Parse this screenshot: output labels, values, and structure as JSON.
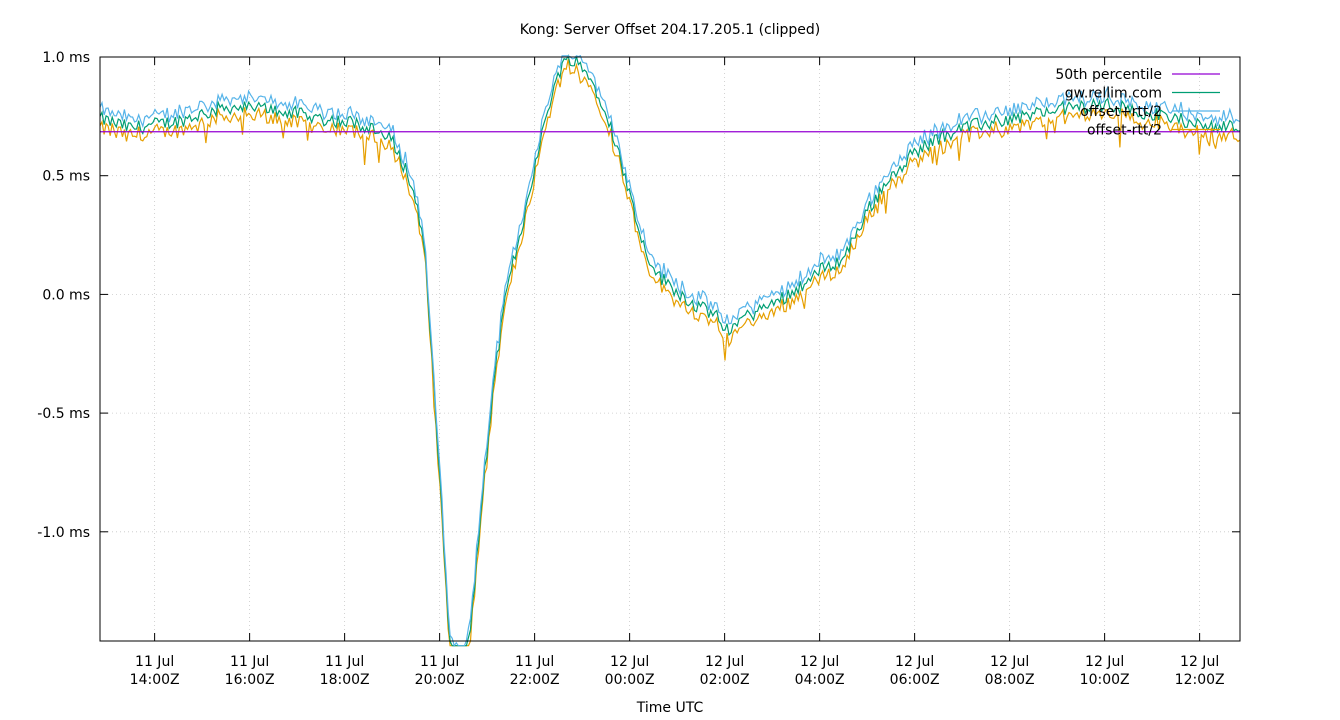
{
  "chart_data": {
    "type": "line",
    "title": "Kong: Server Offset 204.17.205.1 (clipped)",
    "xlabel": "Time UTC",
    "ylabel": "",
    "ylim": [
      -1.46,
      1.0
    ],
    "xlim_hours": [
      12.85,
      36.85
    ],
    "grid": true,
    "legend_position": "top-right",
    "y_ticks": [
      {
        "value": 1.0,
        "label": "1.0 ms"
      },
      {
        "value": 0.5,
        "label": "0.5 ms"
      },
      {
        "value": 0.0,
        "label": "0.0 ms"
      },
      {
        "value": -0.5,
        "label": "-0.5 ms"
      },
      {
        "value": -1.0,
        "label": "-1.0 ms"
      }
    ],
    "x_ticks": [
      {
        "hour": 14,
        "line1": "11 Jul",
        "line2": "14:00Z"
      },
      {
        "hour": 16,
        "line1": "11 Jul",
        "line2": "16:00Z"
      },
      {
        "hour": 18,
        "line1": "11 Jul",
        "line2": "18:00Z"
      },
      {
        "hour": 20,
        "line1": "11 Jul",
        "line2": "20:00Z"
      },
      {
        "hour": 22,
        "line1": "11 Jul",
        "line2": "22:00Z"
      },
      {
        "hour": 24,
        "line1": "12 Jul",
        "line2": "00:00Z"
      },
      {
        "hour": 26,
        "line1": "12 Jul",
        "line2": "02:00Z"
      },
      {
        "hour": 28,
        "line1": "12 Jul",
        "line2": "04:00Z"
      },
      {
        "hour": 30,
        "line1": "12 Jul",
        "line2": "06:00Z"
      },
      {
        "hour": 32,
        "line1": "12 Jul",
        "line2": "08:00Z"
      },
      {
        "hour": 34,
        "line1": "12 Jul",
        "line2": "10:00Z"
      },
      {
        "hour": 36,
        "line1": "12 Jul",
        "line2": "12:00Z"
      }
    ],
    "series": [
      {
        "name": "50th percentile",
        "color": "#9400d3",
        "constant": 0.685
      },
      {
        "name": "gw.rellim.com",
        "color": "#009e73"
      },
      {
        "name": "offset+rtt/2",
        "color": "#56b4e9"
      },
      {
        "name": "offset-rtt/2",
        "color": "#e69f00"
      }
    ],
    "offset_curve": {
      "x_hours": [
        12.85,
        13.5,
        14.5,
        15.5,
        16.5,
        17.5,
        18.3,
        19.0,
        19.3,
        19.55,
        19.7,
        19.85,
        20.0,
        20.2,
        20.4,
        20.55,
        20.7,
        20.9,
        21.1,
        21.3,
        21.5,
        21.7,
        21.9,
        22.1,
        22.3,
        22.5,
        22.7,
        22.9,
        23.1,
        23.3,
        23.5,
        23.7,
        23.9,
        24.1,
        24.3,
        24.6,
        24.9,
        25.2,
        25.5,
        25.8,
        26.0,
        26.3,
        26.6,
        27.0,
        27.5,
        28.0,
        28.5,
        29.0,
        29.5,
        30.0,
        30.5,
        31.0,
        31.5,
        32.0,
        32.5,
        33.0,
        33.5,
        34.0,
        34.5,
        35.0,
        35.5,
        36.0,
        36.5,
        36.85
      ],
      "offset": [
        0.74,
        0.7,
        0.73,
        0.79,
        0.78,
        0.74,
        0.72,
        0.65,
        0.52,
        0.36,
        0.15,
        -0.3,
        -0.75,
        -1.45,
        -1.55,
        -1.55,
        -1.3,
        -0.85,
        -0.45,
        -0.12,
        0.1,
        0.25,
        0.45,
        0.62,
        0.8,
        0.93,
        1.0,
        0.98,
        0.93,
        0.86,
        0.78,
        0.64,
        0.5,
        0.35,
        0.2,
        0.08,
        0.03,
        -0.02,
        -0.06,
        -0.08,
        -0.16,
        -0.11,
        -0.08,
        -0.04,
        0.02,
        0.1,
        0.15,
        0.35,
        0.5,
        0.6,
        0.66,
        0.7,
        0.72,
        0.74,
        0.76,
        0.78,
        0.79,
        0.8,
        0.78,
        0.76,
        0.74,
        0.72,
        0.71,
        0.7
      ],
      "half_rtt": 0.03
    }
  }
}
